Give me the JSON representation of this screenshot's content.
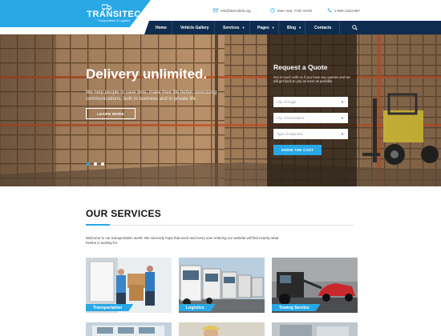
{
  "brand": {
    "name": "TRANSITEC",
    "tagline": "Transportation & Logistics",
    "accent_color": "#29a8e6",
    "nav_color": "#0e2c4e"
  },
  "contact": {
    "email": "info@demolink.org",
    "hours": "Mon–Sat, 7:00–19:00",
    "phone": "1-800-1234-567",
    "icons": [
      "envelope-icon",
      "clock-icon",
      "phone-icon"
    ]
  },
  "nav": {
    "items": [
      {
        "label": "Home",
        "caret": false
      },
      {
        "label": "Vehicle Gallery",
        "caret": false
      },
      {
        "label": "Services",
        "caret": true
      },
      {
        "label": "Pages",
        "caret": true
      },
      {
        "label": "Blog",
        "caret": true
      },
      {
        "label": "Contacts",
        "caret": false
      }
    ],
    "search_icon": "search-icon"
  },
  "hero": {
    "title": "Delivery unlimited.",
    "text": "We help people to save time, make their life better, exercising communications, both in business and in private life.",
    "button": "LEARN MORE",
    "slides": 3,
    "active_slide": 1
  },
  "quote": {
    "title": "Request a Quote",
    "text": "Get in touch with us if you have any queries and we will get back to you as soon as possible.",
    "fields": [
      {
        "placeholder": "City of Origin"
      },
      {
        "placeholder": "City of Destination"
      },
      {
        "placeholder": "Type of Shipment"
      }
    ],
    "button": "KNOW THE COST"
  },
  "services": {
    "title": "OUR SERVICES",
    "intro": "Welcome to our transportation world. We sincerely hope that each and every user entering our website will find exactly what he/she is looking for.",
    "cards": [
      {
        "label": "Transportation"
      },
      {
        "label": "Logistics"
      },
      {
        "label": "Towing Service"
      }
    ]
  }
}
